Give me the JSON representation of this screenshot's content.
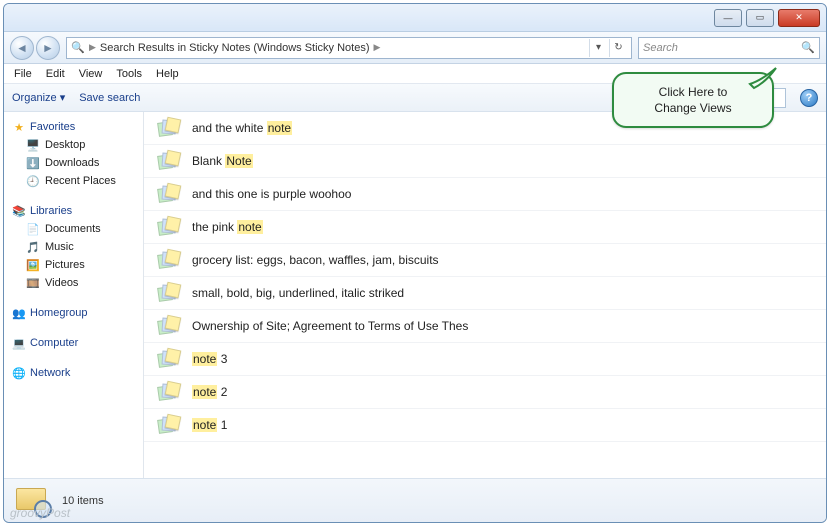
{
  "address": {
    "path": "Search Results in Sticky Notes (Windows Sticky Notes)"
  },
  "search": {
    "placeholder": "Search"
  },
  "menu": [
    "File",
    "Edit",
    "View",
    "Tools",
    "Help"
  ],
  "toolbar": {
    "organize": "Organize",
    "save_search": "Save search"
  },
  "sidebar": {
    "favorites": {
      "label": "Favorites",
      "items": [
        "Desktop",
        "Downloads",
        "Recent Places"
      ]
    },
    "libraries": {
      "label": "Libraries",
      "items": [
        "Documents",
        "Music",
        "Pictures",
        "Videos"
      ]
    },
    "homegroup": "Homegroup",
    "computer": "Computer",
    "network": "Network"
  },
  "results": [
    {
      "segments": [
        {
          "t": "and the white ",
          "hl": false
        },
        {
          "t": "note",
          "hl": true
        }
      ]
    },
    {
      "segments": [
        {
          "t": "Blank ",
          "hl": false
        },
        {
          "t": "Note",
          "hl": true
        }
      ]
    },
    {
      "segments": [
        {
          "t": "and this one is purple woohoo",
          "hl": false
        }
      ]
    },
    {
      "segments": [
        {
          "t": "the pink ",
          "hl": false
        },
        {
          "t": "note",
          "hl": true
        }
      ]
    },
    {
      "segments": [
        {
          "t": "grocery list: eggs, bacon, waffles, jam, biscuits",
          "hl": false
        }
      ]
    },
    {
      "segments": [
        {
          "t": "small, bold,  big,  underlined, italic striked",
          "hl": false
        }
      ]
    },
    {
      "segments": [
        {
          "t": "Ownership of Site; Agreement to Terms of Use Thes",
          "hl": false
        }
      ]
    },
    {
      "segments": [
        {
          "t": "note",
          "hl": true
        },
        {
          "t": " 3",
          "hl": false
        }
      ]
    },
    {
      "segments": [
        {
          "t": "note",
          "hl": true
        },
        {
          "t": " 2",
          "hl": false
        }
      ]
    },
    {
      "segments": [
        {
          "t": "note",
          "hl": true
        },
        {
          "t": " 1",
          "hl": false
        }
      ]
    }
  ],
  "status": {
    "text": "10 items"
  },
  "callout": {
    "line1": "Click Here to",
    "line2": "Change Views"
  },
  "watermark": "groovyPost"
}
